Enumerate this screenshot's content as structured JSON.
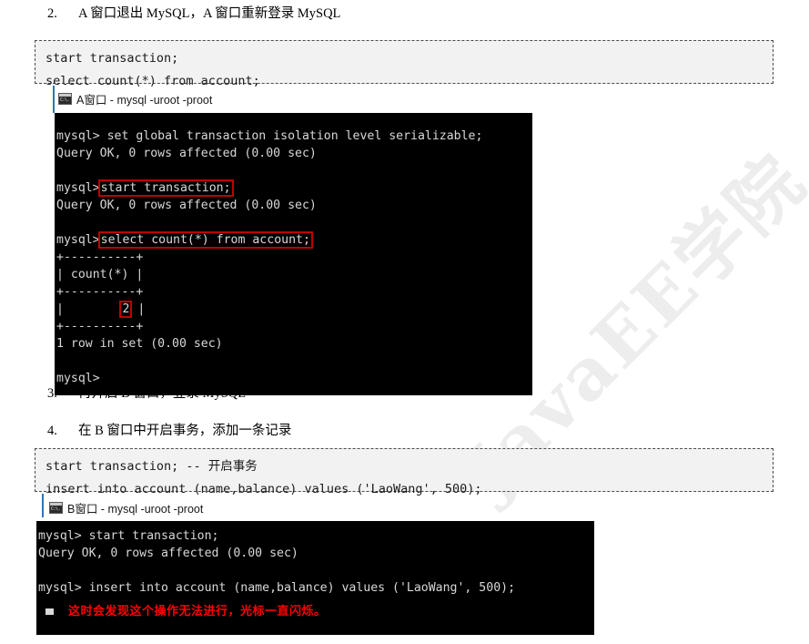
{
  "document": {
    "watermark": "JavaEE学院"
  },
  "steps": [
    {
      "num": "2.",
      "text": "A 窗口退出 MySQL，A 窗口重新登录 MySQL"
    },
    {
      "num": "3.",
      "text": "再开启 B 窗口，登录 MySQL"
    },
    {
      "num": "4.",
      "text": "在 B 窗口中开启事务，添加一条记录"
    }
  ],
  "code_blocks": [
    {
      "name": "code-block-a",
      "lines": [
        "start transaction;",
        "select count(*) from account;"
      ]
    },
    {
      "name": "code-block-b",
      "lines": [
        "start transaction; -- 开启事务",
        "insert into account (name,balance) values ('LaoWang', 500);"
      ]
    }
  ],
  "terminal_a": {
    "title": "A窗口 - mysql  -uroot -proot",
    "icon": "console-icon",
    "lines": [
      {
        "text": "mysql> set global transaction isolation level serializable;"
      },
      {
        "text": "Query OK, 0 rows affected (0.00 sec)"
      },
      {
        "text": ""
      },
      {
        "prompt": "mysql>",
        "highlight": "start transaction;"
      },
      {
        "text": "Query OK, 0 rows affected (0.00 sec)"
      },
      {
        "text": ""
      },
      {
        "prompt": "mysql>",
        "highlight": "select count(*) from account;"
      },
      {
        "text": "+----------+"
      },
      {
        "text": "| count(*) |"
      },
      {
        "text": "+----------+"
      },
      {
        "pre": "|        ",
        "highlight_cell": "2",
        "post": " |"
      },
      {
        "text": "+----------+"
      },
      {
        "text": "1 row in set (0.00 sec)"
      },
      {
        "text": ""
      },
      {
        "text": "mysql>"
      }
    ]
  },
  "terminal_b": {
    "title": "B窗口 - mysql  -uroot -proot",
    "icon": "console-icon",
    "lines": [
      {
        "text": "mysql> start transaction;"
      },
      {
        "text": "Query OK, 0 rows affected (0.00 sec)"
      },
      {
        "text": ""
      },
      {
        "text": "mysql> insert into account (name,balance) values ('LaoWang', 500);"
      }
    ],
    "annotation": "这时会发现这个操作无法进行，光标一直闪烁。"
  },
  "colors": {
    "highlight_red": "#c00000",
    "annotation_red": "#ff0000",
    "terminal_bg": "#000000",
    "terminal_fg": "#d8d8d8",
    "code_bg": "#f2f2f2",
    "watermark": "#ededed",
    "window_edge": "#2e75b6"
  }
}
